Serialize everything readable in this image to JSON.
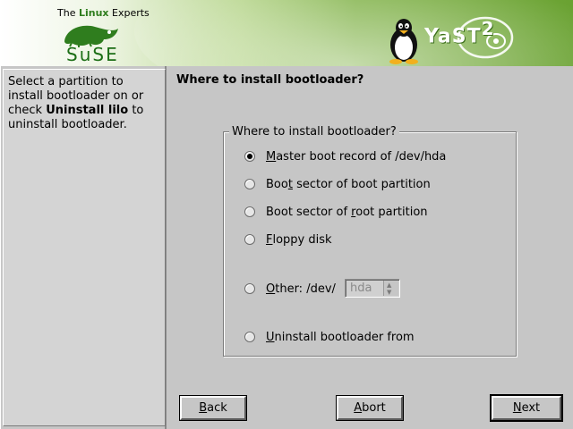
{
  "header": {
    "tagline_pre": "The ",
    "tagline_brand": "Linux",
    "tagline_post": " Experts",
    "company": "SuSE",
    "product": "YaST",
    "product_version": "2",
    "colors": {
      "green_dark": "#2f7d1e",
      "green_light": "#7fb146"
    }
  },
  "help": {
    "text_1": "Select a partition to install bootloader on or check ",
    "bold": "Uninstall lilo",
    "text_2": " to uninstall bootloader."
  },
  "main": {
    "title": "Where to install bootloader?",
    "group_label": "Where to install bootloader?",
    "options": [
      {
        "pre": "",
        "ul": "M",
        "post": "aster boot record of /dev/hda",
        "checked": true
      },
      {
        "pre": "Boo",
        "ul": "t",
        "post": " sector of boot partition",
        "checked": false
      },
      {
        "pre": "Boot sector of ",
        "ul": "r",
        "post": "oot partition",
        "checked": false
      },
      {
        "pre": "",
        "ul": "F",
        "post": "loppy disk",
        "checked": false
      },
      {
        "pre": "",
        "ul": "O",
        "post": "ther: /dev/",
        "checked": false
      },
      {
        "pre": "",
        "ul": "U",
        "post": "ninstall bootloader from",
        "checked": false
      }
    ],
    "other_device": {
      "value": "hda",
      "enabled": false
    }
  },
  "buttons": {
    "back": {
      "ul": "B",
      "post": "ack"
    },
    "abort": {
      "ul": "A",
      "post": "bort"
    },
    "next": {
      "ul": "N",
      "post": "ext"
    }
  }
}
